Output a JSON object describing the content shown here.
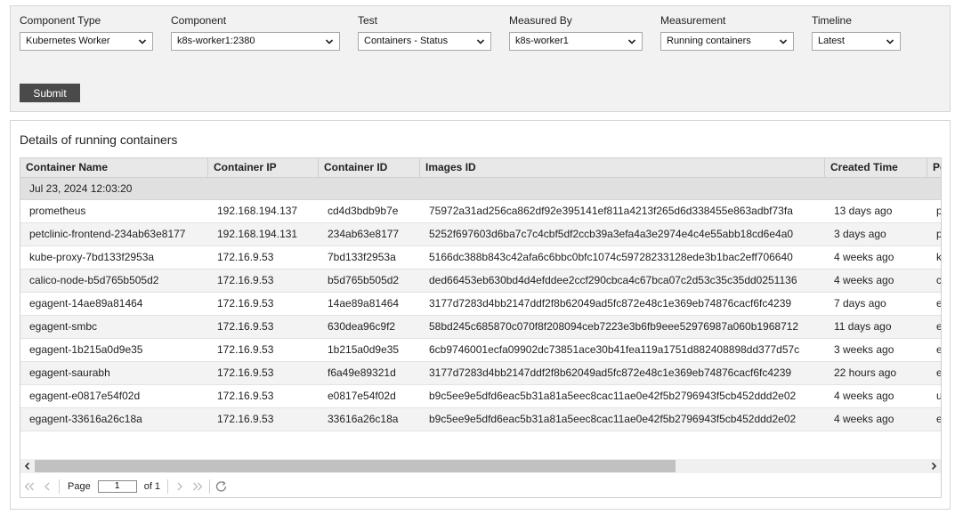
{
  "filters": [
    {
      "label": "Component Type",
      "value": "Kubernetes Worker"
    },
    {
      "label": "Component",
      "value": "k8s-worker1:2380"
    },
    {
      "label": "Test",
      "value": "Containers - Status"
    },
    {
      "label": "Measured By",
      "value": "k8s-worker1"
    },
    {
      "label": "Measurement",
      "value": "Running containers"
    },
    {
      "label": "Timeline",
      "value": "Latest"
    }
  ],
  "submit_label": "Submit",
  "details": {
    "title": "Details of running containers",
    "columns": [
      "Container Name",
      "Container IP",
      "Container ID",
      "Images ID",
      "Created Time",
      "Po"
    ],
    "group_label": "Jul 23, 2024 12:03:20",
    "rows": [
      [
        "prometheus",
        "192.168.194.137",
        "cd4d3bdb9b7e",
        "75972a31ad256ca862df92e395141ef811a4213f265d6d338455e863adbf73fa",
        "13 days ago",
        "p"
      ],
      [
        "petclinic-frontend-234ab63e8177",
        "192.168.194.131",
        "234ab63e8177",
        "5252f697603d6ba7c7c4cbf5df2ccb39a3efa4a3e2974e4c4e55abb18cd6e4a0",
        "3 days ago",
        "p"
      ],
      [
        "kube-proxy-7bd133f2953a",
        "172.16.9.53",
        "7bd133f2953a",
        "5166dc388b843c42afa6c6bbc0bfc1074c59728233128ede3b1bac2eff706640",
        "4 weeks ago",
        "k"
      ],
      [
        "calico-node-b5d765b505d2",
        "172.16.9.53",
        "b5d765b505d2",
        "ded66453eb630bd4d4efddee2ccf290cbca4c67bca07c2d53c35c35dd0251136",
        "4 weeks ago",
        "c"
      ],
      [
        "egagent-14ae89a81464",
        "172.16.9.53",
        "14ae89a81464",
        "3177d7283d4bb2147ddf2f8b62049ad5fc872e48c1e369eb74876cacf6fc4239",
        "7 days ago",
        "e"
      ],
      [
        "egagent-smbc",
        "172.16.9.53",
        "630dea96c9f2",
        "58bd245c685870c070f8f208094ceb7223e3b6fb9eee52976987a060b1968712",
        "11 days ago",
        "e"
      ],
      [
        "egagent-1b215a0d9e35",
        "172.16.9.53",
        "1b215a0d9e35",
        "6cb9746001ecfa09902dc73851ace30b41fea119a1751d882408898dd377d57c",
        "3 weeks ago",
        "e"
      ],
      [
        "egagent-saurabh",
        "172.16.9.53",
        "f6a49e89321d",
        "3177d7283d4bb2147ddf2f8b62049ad5fc872e48c1e369eb74876cacf6fc4239",
        "22 hours ago",
        "e"
      ],
      [
        "egagent-e0817e54f02d",
        "172.16.9.53",
        "e0817e54f02d",
        "b9c5ee9e5dfd6eac5b31a81a5eec8cac11ae0e42f5b2796943f5cb452ddd2e02",
        "4 weeks ago",
        "u"
      ],
      [
        "egagent-33616a26c18a",
        "172.16.9.53",
        "33616a26c18a",
        "b9c5ee9e5dfd6eac5b31a81a5eec8cac11ae0e42f5b2796943f5cb452ddd2e02",
        "4 weeks ago",
        "e"
      ]
    ]
  },
  "pager": {
    "page_label": "Page",
    "page_value": "1",
    "of_label": "of 1"
  },
  "icons": {
    "select_arrow": "chevron-down-icon",
    "first": "first-page-icon",
    "prev": "prev-page-icon",
    "next": "next-page-icon",
    "last": "last-page-icon",
    "refresh": "refresh-icon",
    "scroll_left": "scroll-left-icon",
    "scroll_right": "scroll-right-icon"
  },
  "colors": {
    "submit_bg": "#4a4a4a",
    "panel_bg": "#f2f2f2",
    "header_bg": "#e8e8e8",
    "group_bg": "#e0e0e0",
    "alt_row_bg": "#f3f3f3"
  }
}
